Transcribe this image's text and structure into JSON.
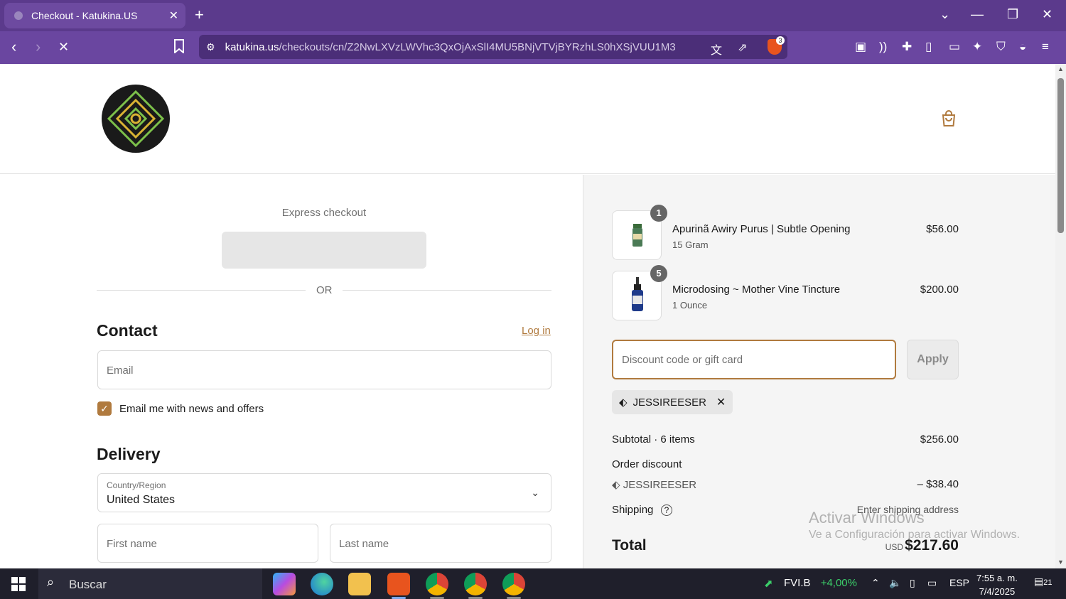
{
  "browser": {
    "tab_title": "Checkout - Katukina.US",
    "tab_close": "✕",
    "new_tab": "+",
    "url_host": "katukina.us",
    "url_path": "/checkouts/cn/Z2NwLXVzLWVhc3QxOjAxSlI4MU5BNjVTVjBYRzhLS0hXSjVUU1M3",
    "brave_badge": "3"
  },
  "checkout": {
    "express_title": "Express checkout",
    "or": "OR",
    "contact_title": "Contact",
    "login_link": "Log in",
    "email_placeholder": "Email",
    "newsletter_label": "Email me with news and offers",
    "newsletter_checked": true,
    "delivery_title": "Delivery",
    "country_label": "Country/Region",
    "country_value": "United States",
    "first_name_placeholder": "First name",
    "last_name_placeholder": "Last name"
  },
  "summary": {
    "items": [
      {
        "qty": "1",
        "name": "Apurinã Awiry Purus | Subtle Opening",
        "variant": "15 Gram",
        "price": "$56.00"
      },
      {
        "qty": "5",
        "name": "Microdosing ~ Mother Vine Tincture",
        "variant": "1 Ounce",
        "price": "$200.00"
      }
    ],
    "discount_placeholder": "Discount code or gift card",
    "apply": "Apply",
    "applied_code": "JESSIREESER",
    "subtotal_label": "Subtotal · 6 items",
    "subtotal_value": "$256.00",
    "order_discount_label": "Order discount",
    "discount_code": "JESSIREESER",
    "discount_value": "– $38.40",
    "shipping_label": "Shipping",
    "shipping_value": "Enter shipping address",
    "total_label": "Total",
    "currency": "USD",
    "total_value": "$217.60"
  },
  "watermark": {
    "line1": "Activar Windows",
    "line2": "Ve a Configuración para activar Windows."
  },
  "taskbar": {
    "search": "Buscar",
    "stock_name": "FVI.B",
    "stock_change": "+4,00%",
    "lang": "ESP",
    "time": "7:55 a. m.",
    "date": "7/4/2025",
    "notifications": "21"
  },
  "colors": {
    "accent": "#b07a3e",
    "chrome": "#5b3a8c"
  }
}
